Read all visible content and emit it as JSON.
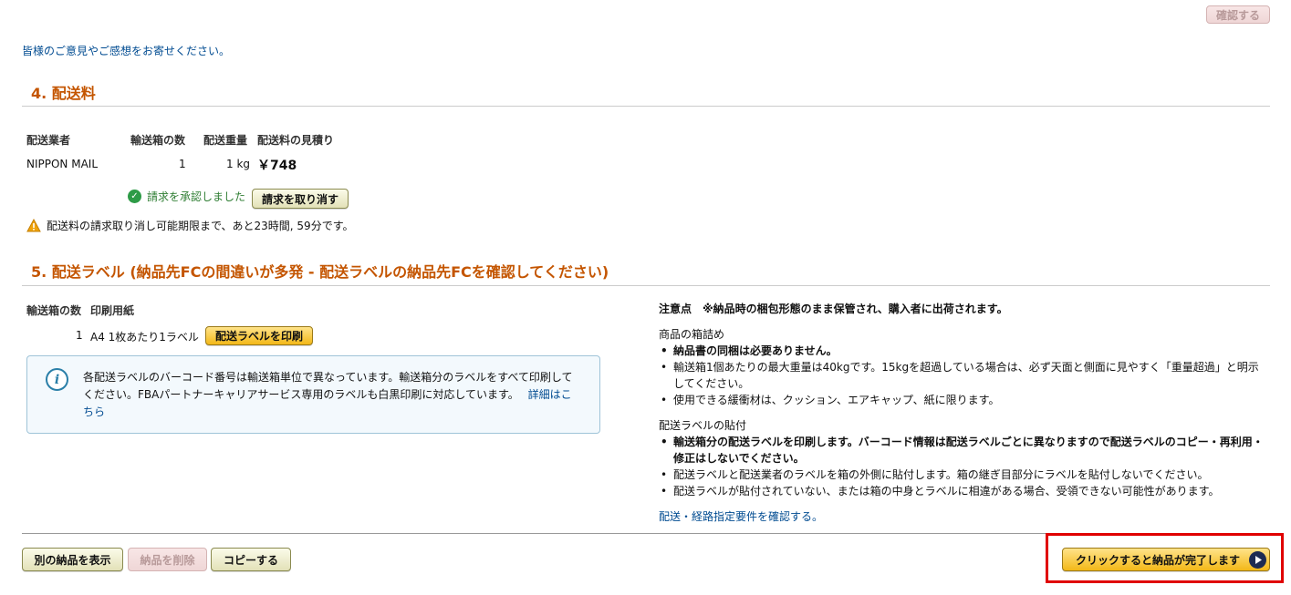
{
  "top": {
    "confirm_button": "確認する",
    "feedback_link": "皆様のご意見やご感想をお寄せください。"
  },
  "section4": {
    "title": "4. 配送料",
    "headers": [
      "配送業者",
      "輸送箱の数",
      "配送重量",
      "配送料の見積り"
    ],
    "row": {
      "carrier": "NIPPON MAIL",
      "boxes": "1",
      "weight": "1 kg",
      "estimate": "￥748"
    },
    "accepted_text": "請求を承認しました",
    "cancel_button": "請求を取り消す",
    "warning": "配送料の請求取り消し可能期限まで、あと23時間, 59分です。"
  },
  "section5": {
    "title": "5. 配送ラベル (納品先FCの間違いが多発 - 配送ラベルの納品先FCを確認してください)",
    "headers": [
      "輸送箱の数",
      "印刷用紙"
    ],
    "row": {
      "boxes": "1",
      "paper": "A4 1枚あたり1ラベル"
    },
    "print_button": "配送ラベルを印刷",
    "info_text": "各配送ラベルのバーコード番号は輸送箱単位で異なっています。輸送箱分のラベルをすべて印刷してください。FBAパートナーキャリアサービス専用のラベルも白黒印刷に対応しています。",
    "info_link": "詳細はこちら"
  },
  "notes": {
    "heading": "注意点　※納品時の梱包形態のまま保管され、購入者に出荷されます。",
    "packing_title": "商品の箱詰め",
    "packing_items": [
      "納品書の同梱は必要ありません。",
      "輸送箱1個あたりの最大重量は40kgです。15kgを超過している場合は、必ず天面と側面に見やすく「重量超過」と明示してください。",
      "使用できる緩衝材は、クッション、エアキャップ、紙に限ります。"
    ],
    "label_title": "配送ラベルの貼付",
    "label_items": [
      "輸送箱分の配送ラベルを印刷します。バーコード情報は配送ラベルごとに異なりますので配送ラベルのコピー・再利用・修正はしないでください。",
      "配送ラベルと配送業者のラベルを箱の外側に貼付します。箱の継ぎ目部分にラベルを貼付しないでください。",
      "配送ラベルが貼付されていない、または箱の中身とラベルに相違がある場合、受領できない可能性があります。"
    ],
    "requirements_link": "配送・経路指定要件を確認する。"
  },
  "footer": {
    "show_other": "別の納品を表示",
    "delete": "納品を削除",
    "copy": "コピーする",
    "complete": "クリックすると納品が完了します"
  },
  "colors": {
    "accent": "#c45500",
    "highlight": "#e00000",
    "link": "#004b91"
  }
}
